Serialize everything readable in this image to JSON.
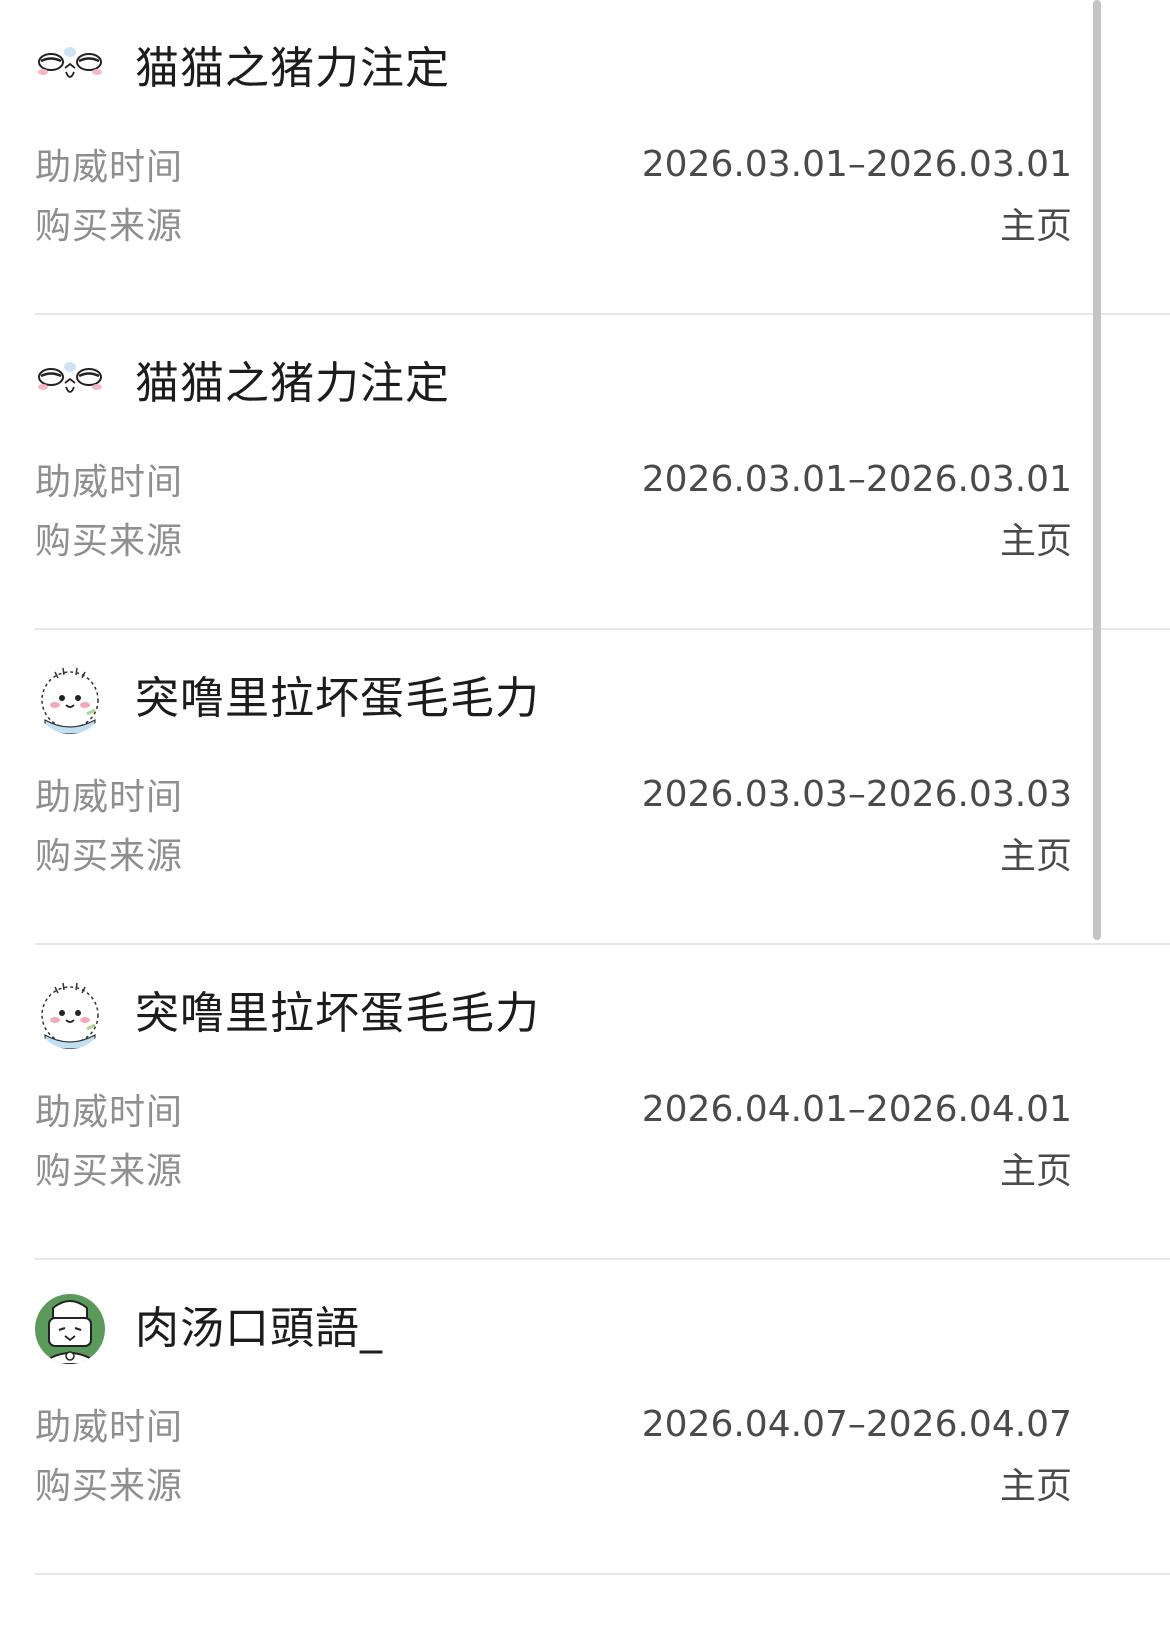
{
  "labels": {
    "time": "助威时间",
    "source": "购买来源"
  },
  "records": [
    {
      "username": "猫猫之猪力注定",
      "avatar_icon": "cat-face-icon",
      "time": "2026.03.01–2026.03.01",
      "source": "主页"
    },
    {
      "username": "猫猫之猪力注定",
      "avatar_icon": "cat-face-icon",
      "time": "2026.03.01–2026.03.01",
      "source": "主页"
    },
    {
      "username": "突噜里拉坏蛋毛毛力",
      "avatar_icon": "fluffy-creature-icon",
      "time": "2026.03.03–2026.03.03",
      "source": "主页"
    },
    {
      "username": "突噜里拉坏蛋毛毛力",
      "avatar_icon": "fluffy-creature-icon",
      "time": "2026.04.01–2026.04.01",
      "source": "主页"
    },
    {
      "username": "肉汤口頭語_",
      "avatar_icon": "chef-bear-icon",
      "time": "2026.04.07–2026.04.07",
      "source": "主页"
    }
  ],
  "colors": {
    "label": "#8f8f8f",
    "value": "#4a4a4a",
    "divider": "#e7e7e7",
    "avatar_green": "#5a9a5a"
  }
}
